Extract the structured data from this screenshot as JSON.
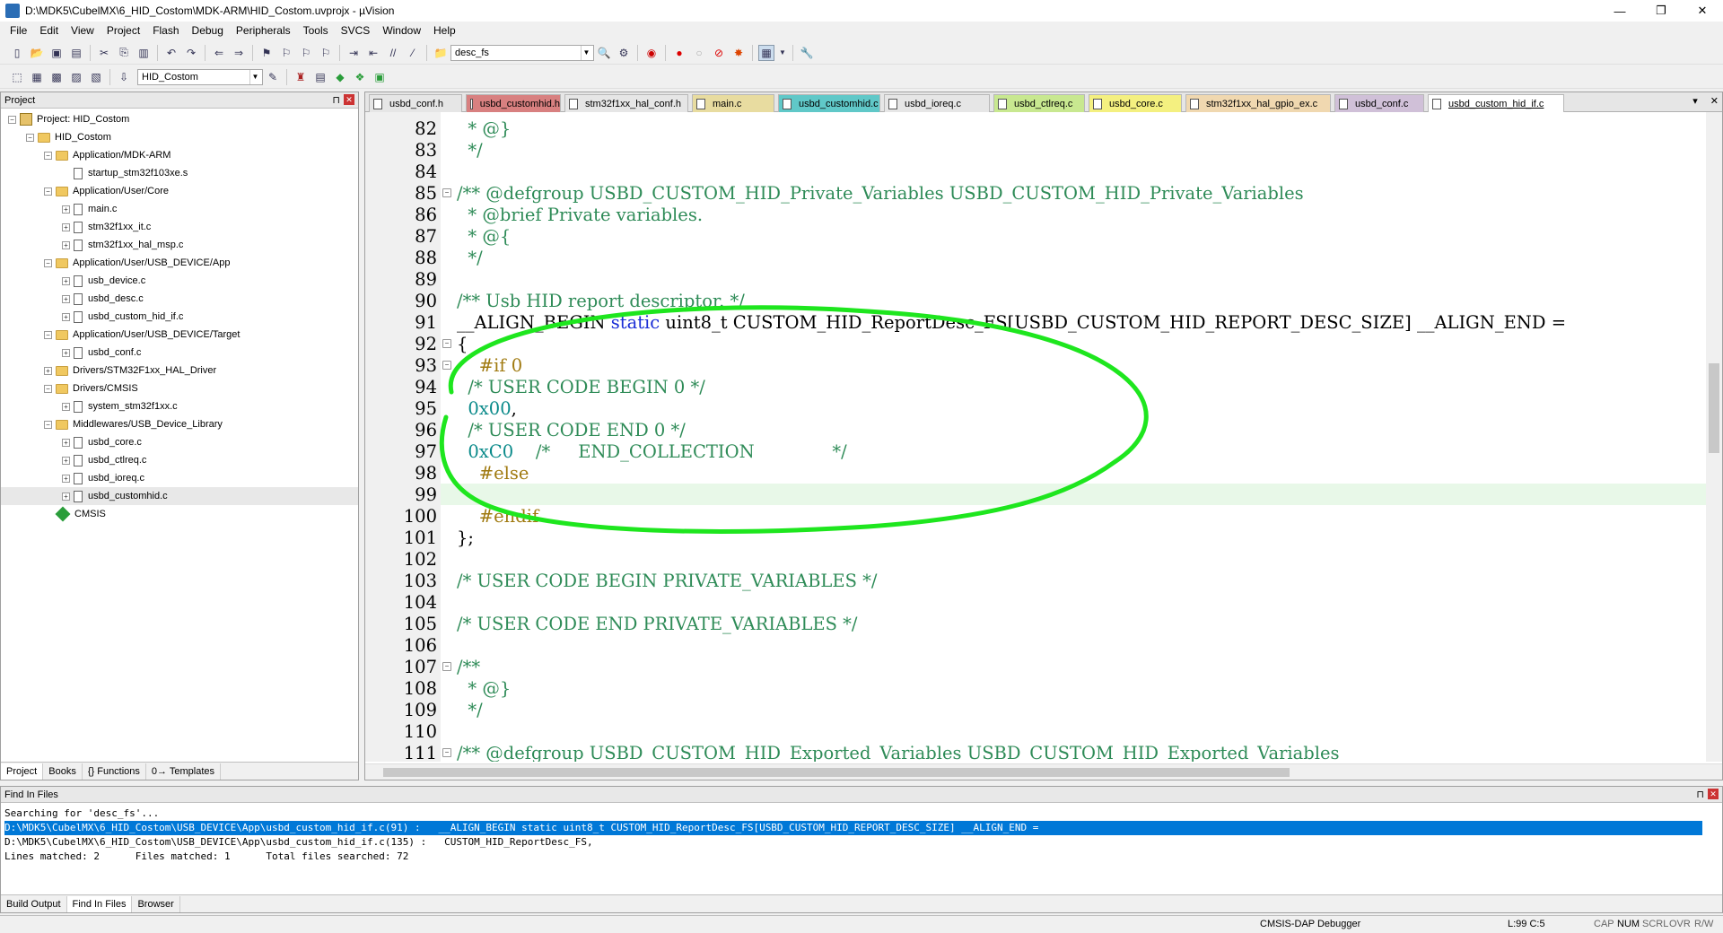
{
  "window": {
    "title": "D:\\MDK5\\CubelMX\\6_HID_Costom\\MDK-ARM\\HID_Costom.uvprojx - µVision",
    "minimize": "—",
    "maximize": "❐",
    "close": "✕"
  },
  "menu": [
    "File",
    "Edit",
    "View",
    "Project",
    "Flash",
    "Debug",
    "Peripherals",
    "Tools",
    "SVCS",
    "Window",
    "Help"
  ],
  "toolbar": {
    "find_combo": "desc_fs",
    "target_combo": "HID_Costom"
  },
  "project_panel": {
    "title": "Project",
    "tree": [
      {
        "label": "Project: HID_Costom",
        "depth": 0,
        "kind": "project",
        "exp": "−"
      },
      {
        "label": "HID_Costom",
        "depth": 1,
        "kind": "folder",
        "exp": "−"
      },
      {
        "label": "Application/MDK-ARM",
        "depth": 2,
        "kind": "folder",
        "exp": "−"
      },
      {
        "label": "startup_stm32f103xe.s",
        "depth": 3,
        "kind": "file",
        "exp": ""
      },
      {
        "label": "Application/User/Core",
        "depth": 2,
        "kind": "folder",
        "exp": "−"
      },
      {
        "label": "main.c",
        "depth": 3,
        "kind": "file",
        "exp": "+"
      },
      {
        "label": "stm32f1xx_it.c",
        "depth": 3,
        "kind": "file",
        "exp": "+"
      },
      {
        "label": "stm32f1xx_hal_msp.c",
        "depth": 3,
        "kind": "file",
        "exp": "+"
      },
      {
        "label": "Application/User/USB_DEVICE/App",
        "depth": 2,
        "kind": "folder",
        "exp": "−"
      },
      {
        "label": "usb_device.c",
        "depth": 3,
        "kind": "file",
        "exp": "+"
      },
      {
        "label": "usbd_desc.c",
        "depth": 3,
        "kind": "file",
        "exp": "+"
      },
      {
        "label": "usbd_custom_hid_if.c",
        "depth": 3,
        "kind": "file",
        "exp": "+"
      },
      {
        "label": "Application/User/USB_DEVICE/Target",
        "depth": 2,
        "kind": "folder",
        "exp": "−"
      },
      {
        "label": "usbd_conf.c",
        "depth": 3,
        "kind": "file",
        "exp": "+"
      },
      {
        "label": "Drivers/STM32F1xx_HAL_Driver",
        "depth": 2,
        "kind": "folder",
        "exp": "+"
      },
      {
        "label": "Drivers/CMSIS",
        "depth": 2,
        "kind": "folder",
        "exp": "−"
      },
      {
        "label": "system_stm32f1xx.c",
        "depth": 3,
        "kind": "file",
        "exp": "+"
      },
      {
        "label": "Middlewares/USB_Device_Library",
        "depth": 2,
        "kind": "folder",
        "exp": "−"
      },
      {
        "label": "usbd_core.c",
        "depth": 3,
        "kind": "file",
        "exp": "+"
      },
      {
        "label": "usbd_ctlreq.c",
        "depth": 3,
        "kind": "file",
        "exp": "+"
      },
      {
        "label": "usbd_ioreq.c",
        "depth": 3,
        "kind": "file",
        "exp": "+"
      },
      {
        "label": "usbd_customhid.c",
        "depth": 3,
        "kind": "file",
        "exp": "+",
        "selected": true
      },
      {
        "label": "CMSIS",
        "depth": 2,
        "kind": "gem",
        "exp": ""
      }
    ],
    "tabs": [
      "Project",
      "Books",
      "{} Functions",
      "0→ Templates"
    ]
  },
  "editor": {
    "tabs": [
      {
        "label": "usbd_conf.h",
        "color": "#e6e6e6"
      },
      {
        "label": "usbd_customhid.h",
        "color": "#d88080"
      },
      {
        "label": "stm32f1xx_hal_conf.h",
        "color": "#e6e6e6"
      },
      {
        "label": "main.c",
        "color": "#e8dca0"
      },
      {
        "label": "usbd_customhid.c",
        "color": "#60c8c8"
      },
      {
        "label": "usbd_ioreq.c",
        "color": "#e6e6e6"
      },
      {
        "label": "usbd_ctlreq.c",
        "color": "#c8e890"
      },
      {
        "label": "usbd_core.c",
        "color": "#f4f080"
      },
      {
        "label": "stm32f1xx_hal_gpio_ex.c",
        "color": "#f0d8b0"
      },
      {
        "label": "usbd_conf.c",
        "color": "#d0c0d8"
      },
      {
        "label": "usbd_custom_hid_if.c",
        "color": "#ffffff",
        "active": true
      }
    ],
    "lines": [
      {
        "n": "82",
        "fold": "",
        "segs": [
          [
            "cm",
            "  * @}"
          ]
        ]
      },
      {
        "n": "83",
        "fold": "",
        "segs": [
          [
            "cm",
            "  */"
          ]
        ]
      },
      {
        "n": "84",
        "fold": "",
        "segs": []
      },
      {
        "n": "85",
        "fold": "−",
        "segs": [
          [
            "cm",
            "/** @defgroup USBD_CUSTOM_HID_Private_Variables USBD_CUSTOM_HID_Private_Variables"
          ]
        ]
      },
      {
        "n": "86",
        "fold": "",
        "segs": [
          [
            "cm",
            "  * @brief Private variables."
          ]
        ]
      },
      {
        "n": "87",
        "fold": "",
        "segs": [
          [
            "cm",
            "  * @{"
          ]
        ]
      },
      {
        "n": "88",
        "fold": "",
        "segs": [
          [
            "cm",
            "  */"
          ]
        ]
      },
      {
        "n": "89",
        "fold": "",
        "segs": []
      },
      {
        "n": "90",
        "fold": "",
        "segs": [
          [
            "cm",
            "/** Usb HID report descriptor. */"
          ]
        ]
      },
      {
        "n": "91",
        "fold": "",
        "segs": [
          [
            "",
            "__ALIGN_BEGIN "
          ],
          [
            "kw",
            "static"
          ],
          [
            "",
            " uint8_t CUSTOM_HID_ReportDesc_FS[USBD_CUSTOM_HID_REPORT_DESC_SIZE] __ALIGN_END ="
          ]
        ]
      },
      {
        "n": "92",
        "fold": "−",
        "segs": [
          [
            "",
            "{"
          ]
        ]
      },
      {
        "n": "93",
        "fold": "−",
        "segs": [
          [
            "pp",
            "    #if 0"
          ]
        ]
      },
      {
        "n": "94",
        "fold": "",
        "segs": [
          [
            "cm",
            "  /* USER CODE BEGIN 0 */"
          ]
        ]
      },
      {
        "n": "95",
        "fold": "",
        "segs": [
          [
            "nm",
            "  0x00"
          ],
          [
            "",
            ","
          ]
        ]
      },
      {
        "n": "96",
        "fold": "",
        "segs": [
          [
            "cm",
            "  /* USER CODE END 0 */"
          ]
        ]
      },
      {
        "n": "97",
        "fold": "",
        "segs": [
          [
            "nm",
            "  0xC0"
          ],
          [
            "cm",
            "    /*     END_COLLECTION              */"
          ]
        ]
      },
      {
        "n": "98",
        "fold": "",
        "segs": [
          [
            "pp",
            "    #else"
          ]
        ]
      },
      {
        "n": "99",
        "fold": "",
        "segs": [],
        "current": true
      },
      {
        "n": "100",
        "fold": "",
        "segs": [
          [
            "pp",
            "    #endif"
          ]
        ]
      },
      {
        "n": "101",
        "fold": "",
        "segs": [
          [
            "",
            "};"
          ]
        ]
      },
      {
        "n": "102",
        "fold": "",
        "segs": []
      },
      {
        "n": "103",
        "fold": "",
        "segs": [
          [
            "cm",
            "/* USER CODE BEGIN PRIVATE_VARIABLES */"
          ]
        ]
      },
      {
        "n": "104",
        "fold": "",
        "segs": []
      },
      {
        "n": "105",
        "fold": "",
        "segs": [
          [
            "cm",
            "/* USER CODE END PRIVATE_VARIABLES */"
          ]
        ]
      },
      {
        "n": "106",
        "fold": "",
        "segs": []
      },
      {
        "n": "107",
        "fold": "−",
        "segs": [
          [
            "cm",
            "/**"
          ]
        ]
      },
      {
        "n": "108",
        "fold": "",
        "segs": [
          [
            "cm",
            "  * @}"
          ]
        ]
      },
      {
        "n": "109",
        "fold": "",
        "segs": [
          [
            "cm",
            "  */"
          ]
        ]
      },
      {
        "n": "110",
        "fold": "",
        "segs": []
      },
      {
        "n": "111",
        "fold": "−",
        "segs": [
          [
            "cm",
            "/** @defgroup USBD_CUSTOM_HID_Exported_Variables USBD_CUSTOM_HID_Exported_Variables"
          ]
        ]
      }
    ]
  },
  "find_panel": {
    "title": "Find In Files",
    "lines": [
      {
        "text": "Searching for 'desc_fs'...",
        "hl": false
      },
      {
        "text": "D:\\MDK5\\CubelMX\\6_HID_Costom\\USB_DEVICE\\App\\usbd_custom_hid_if.c(91) :   __ALIGN_BEGIN static uint8_t CUSTOM_HID_ReportDesc_FS[USBD_CUSTOM_HID_REPORT_DESC_SIZE] __ALIGN_END =",
        "hl": true
      },
      {
        "text": "D:\\MDK5\\CubelMX\\6_HID_Costom\\USB_DEVICE\\App\\usbd_custom_hid_if.c(135) :   CUSTOM_HID_ReportDesc_FS,",
        "hl": false
      },
      {
        "text": "Lines matched: 2      Files matched: 1      Total files searched: 72",
        "hl": false
      }
    ],
    "tabs": [
      "Build Output",
      "Find In Files",
      "Browser"
    ]
  },
  "status": {
    "debugger": "CMSIS-DAP Debugger",
    "position": "L:99 C:5",
    "cap": "CAP",
    "num": "NUM",
    "scrl": "SCRL",
    "ovr": "OVR",
    "rw": "R/W"
  }
}
